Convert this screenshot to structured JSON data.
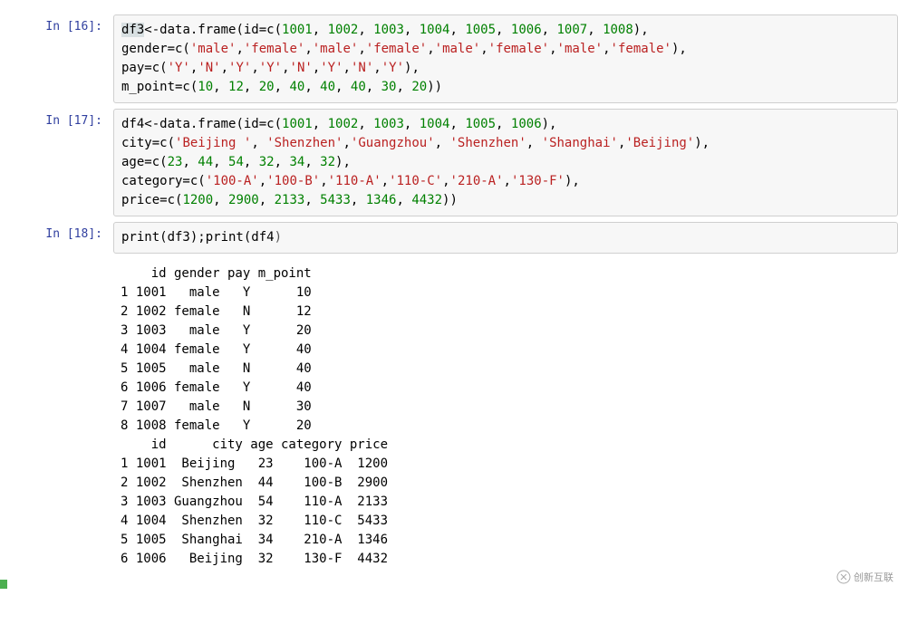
{
  "cells": [
    {
      "prompt": "In  [16]:",
      "tokens": [
        {
          "t": "df3",
          "c": "t-name",
          "h": true
        },
        {
          "t": "<-data.frame(id=c(",
          "c": "t-name"
        },
        {
          "t": "1001",
          "c": "t-num"
        },
        {
          "t": ", ",
          "c": "t-name"
        },
        {
          "t": "1002",
          "c": "t-num"
        },
        {
          "t": ", ",
          "c": "t-name"
        },
        {
          "t": "1003",
          "c": "t-num"
        },
        {
          "t": ", ",
          "c": "t-name"
        },
        {
          "t": "1004",
          "c": "t-num"
        },
        {
          "t": ", ",
          "c": "t-name"
        },
        {
          "t": "1005",
          "c": "t-num"
        },
        {
          "t": ", ",
          "c": "t-name"
        },
        {
          "t": "1006",
          "c": "t-num"
        },
        {
          "t": ", ",
          "c": "t-name"
        },
        {
          "t": "1007",
          "c": "t-num"
        },
        {
          "t": ", ",
          "c": "t-name"
        },
        {
          "t": "1008",
          "c": "t-num"
        },
        {
          "t": "),\n",
          "c": "t-name"
        },
        {
          "t": "gender=c(",
          "c": "t-name"
        },
        {
          "t": "'male'",
          "c": "t-str"
        },
        {
          "t": ",",
          "c": "t-name"
        },
        {
          "t": "'female'",
          "c": "t-str"
        },
        {
          "t": ",",
          "c": "t-name"
        },
        {
          "t": "'male'",
          "c": "t-str"
        },
        {
          "t": ",",
          "c": "t-name"
        },
        {
          "t": "'female'",
          "c": "t-str"
        },
        {
          "t": ",",
          "c": "t-name"
        },
        {
          "t": "'male'",
          "c": "t-str"
        },
        {
          "t": ",",
          "c": "t-name"
        },
        {
          "t": "'female'",
          "c": "t-str"
        },
        {
          "t": ",",
          "c": "t-name"
        },
        {
          "t": "'male'",
          "c": "t-str"
        },
        {
          "t": ",",
          "c": "t-name"
        },
        {
          "t": "'female'",
          "c": "t-str"
        },
        {
          "t": "),\n",
          "c": "t-name"
        },
        {
          "t": "pay=c(",
          "c": "t-name"
        },
        {
          "t": "'Y'",
          "c": "t-str"
        },
        {
          "t": ",",
          "c": "t-name"
        },
        {
          "t": "'N'",
          "c": "t-str"
        },
        {
          "t": ",",
          "c": "t-name"
        },
        {
          "t": "'Y'",
          "c": "t-str"
        },
        {
          "t": ",",
          "c": "t-name"
        },
        {
          "t": "'Y'",
          "c": "t-str"
        },
        {
          "t": ",",
          "c": "t-name"
        },
        {
          "t": "'N'",
          "c": "t-str"
        },
        {
          "t": ",",
          "c": "t-name"
        },
        {
          "t": "'Y'",
          "c": "t-str"
        },
        {
          "t": ",",
          "c": "t-name"
        },
        {
          "t": "'N'",
          "c": "t-str"
        },
        {
          "t": ",",
          "c": "t-name"
        },
        {
          "t": "'Y'",
          "c": "t-str"
        },
        {
          "t": "),\n",
          "c": "t-name"
        },
        {
          "t": "m_point=c(",
          "c": "t-name"
        },
        {
          "t": "10",
          "c": "t-num"
        },
        {
          "t": ", ",
          "c": "t-name"
        },
        {
          "t": "12",
          "c": "t-num"
        },
        {
          "t": ", ",
          "c": "t-name"
        },
        {
          "t": "20",
          "c": "t-num"
        },
        {
          "t": ", ",
          "c": "t-name"
        },
        {
          "t": "40",
          "c": "t-num"
        },
        {
          "t": ", ",
          "c": "t-name"
        },
        {
          "t": "40",
          "c": "t-num"
        },
        {
          "t": ", ",
          "c": "t-name"
        },
        {
          "t": "40",
          "c": "t-num"
        },
        {
          "t": ", ",
          "c": "t-name"
        },
        {
          "t": "30",
          "c": "t-num"
        },
        {
          "t": ", ",
          "c": "t-name"
        },
        {
          "t": "20",
          "c": "t-num"
        },
        {
          "t": "))",
          "c": "t-name"
        }
      ]
    },
    {
      "prompt": "In  [17]:",
      "tokens": [
        {
          "t": "df4",
          "c": "t-name"
        },
        {
          "t": "<-data.frame(id=c(",
          "c": "t-name"
        },
        {
          "t": "1001",
          "c": "t-num"
        },
        {
          "t": ", ",
          "c": "t-name"
        },
        {
          "t": "1002",
          "c": "t-num"
        },
        {
          "t": ", ",
          "c": "t-name"
        },
        {
          "t": "1003",
          "c": "t-num"
        },
        {
          "t": ", ",
          "c": "t-name"
        },
        {
          "t": "1004",
          "c": "t-num"
        },
        {
          "t": ", ",
          "c": "t-name"
        },
        {
          "t": "1005",
          "c": "t-num"
        },
        {
          "t": ", ",
          "c": "t-name"
        },
        {
          "t": "1006",
          "c": "t-num"
        },
        {
          "t": "),\n",
          "c": "t-name"
        },
        {
          "t": "city=c(",
          "c": "t-name"
        },
        {
          "t": "'Beijing '",
          "c": "t-str"
        },
        {
          "t": ", ",
          "c": "t-name"
        },
        {
          "t": "'Shenzhen'",
          "c": "t-str"
        },
        {
          "t": ",",
          "c": "t-name"
        },
        {
          "t": "'Guangzhou'",
          "c": "t-str"
        },
        {
          "t": ", ",
          "c": "t-name"
        },
        {
          "t": "'Shenzhen'",
          "c": "t-str"
        },
        {
          "t": ", ",
          "c": "t-name"
        },
        {
          "t": "'Shanghai'",
          "c": "t-str"
        },
        {
          "t": ",",
          "c": "t-name"
        },
        {
          "t": "'Beijing'",
          "c": "t-str"
        },
        {
          "t": "),\n",
          "c": "t-name"
        },
        {
          "t": "age=c(",
          "c": "t-name"
        },
        {
          "t": "23",
          "c": "t-num"
        },
        {
          "t": ", ",
          "c": "t-name"
        },
        {
          "t": "44",
          "c": "t-num"
        },
        {
          "t": ", ",
          "c": "t-name"
        },
        {
          "t": "54",
          "c": "t-num"
        },
        {
          "t": ", ",
          "c": "t-name"
        },
        {
          "t": "32",
          "c": "t-num"
        },
        {
          "t": ", ",
          "c": "t-name"
        },
        {
          "t": "34",
          "c": "t-num"
        },
        {
          "t": ", ",
          "c": "t-name"
        },
        {
          "t": "32",
          "c": "t-num"
        },
        {
          "t": "),\n",
          "c": "t-name"
        },
        {
          "t": "category=c(",
          "c": "t-name"
        },
        {
          "t": "'100-A'",
          "c": "t-str"
        },
        {
          "t": ",",
          "c": "t-name"
        },
        {
          "t": "'100-B'",
          "c": "t-str"
        },
        {
          "t": ",",
          "c": "t-name"
        },
        {
          "t": "'110-A'",
          "c": "t-str"
        },
        {
          "t": ",",
          "c": "t-name"
        },
        {
          "t": "'110-C'",
          "c": "t-str"
        },
        {
          "t": ",",
          "c": "t-name"
        },
        {
          "t": "'210-A'",
          "c": "t-str"
        },
        {
          "t": ",",
          "c": "t-name"
        },
        {
          "t": "'130-F'",
          "c": "t-str"
        },
        {
          "t": "),\n",
          "c": "t-name"
        },
        {
          "t": "price=c(",
          "c": "t-name"
        },
        {
          "t": "1200",
          "c": "t-num"
        },
        {
          "t": ", ",
          "c": "t-name"
        },
        {
          "t": "2900",
          "c": "t-num"
        },
        {
          "t": ", ",
          "c": "t-name"
        },
        {
          "t": "2133",
          "c": "t-num"
        },
        {
          "t": ", ",
          "c": "t-name"
        },
        {
          "t": "5433",
          "c": "t-num"
        },
        {
          "t": ", ",
          "c": "t-name"
        },
        {
          "t": "1346",
          "c": "t-num"
        },
        {
          "t": ", ",
          "c": "t-name"
        },
        {
          "t": "4432",
          "c": "t-num"
        },
        {
          "t": "))",
          "c": "t-name"
        }
      ]
    },
    {
      "prompt": "In  [18]:",
      "tokens": [
        {
          "t": "print(df3);print(df4",
          "c": "t-name"
        },
        {
          "t": ")",
          "c": "t-op"
        }
      ]
    }
  ],
  "output": "    id gender pay m_point\n1 1001   male   Y      10\n2 1002 female   N      12\n3 1003   male   Y      20\n4 1004 female   Y      40\n5 1005   male   N      40\n6 1006 female   Y      40\n7 1007   male   N      30\n8 1008 female   Y      20\n    id      city age category price\n1 1001  Beijing   23    100-A  1200\n2 1002  Shenzhen  44    100-B  2900\n3 1003 Guangzhou  54    110-A  2133\n4 1004  Shenzhen  32    110-C  5433\n5 1005  Shanghai  34    210-A  1346\n6 1006   Beijing  32    130-F  4432",
  "watermark": "创新互联"
}
